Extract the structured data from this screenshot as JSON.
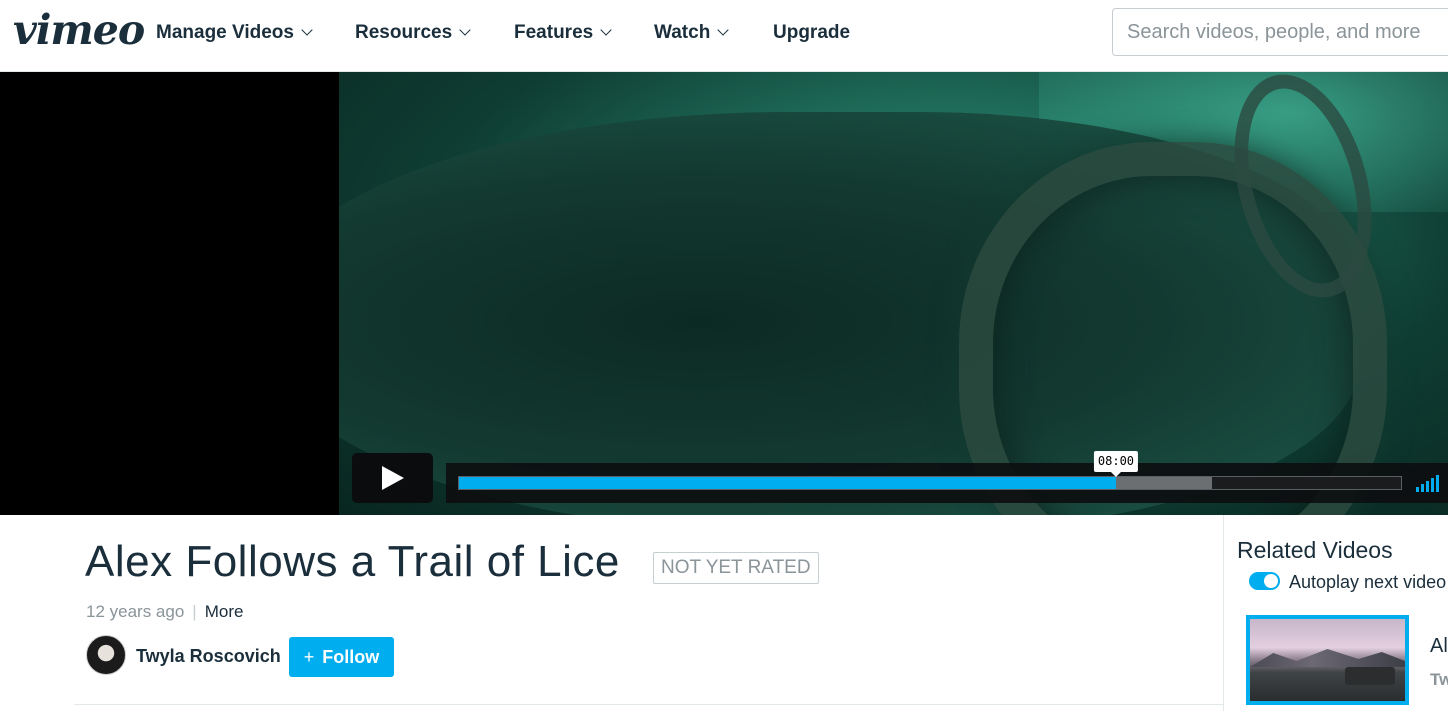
{
  "nav": {
    "logo": "vimeo",
    "items": [
      {
        "label": "Manage Videos",
        "has_dropdown": true
      },
      {
        "label": "Resources",
        "has_dropdown": true
      },
      {
        "label": "Features",
        "has_dropdown": true
      },
      {
        "label": "Watch",
        "has_dropdown": true
      },
      {
        "label": "Upgrade",
        "has_dropdown": false
      }
    ],
    "search_placeholder": "Search videos, people, and more"
  },
  "player": {
    "play_icon": "play-icon",
    "progress_played_fraction": 0.697,
    "progress_buffered_fraction": 0.799,
    "hover_time": "08:00",
    "accent_color": "#00adef"
  },
  "video": {
    "title": "Alex Follows a Trail of Lice",
    "rating": "NOT YET RATED",
    "age": "12 years ago",
    "more_label": "More",
    "owner": "Twyla Roscovich",
    "follow_label": "Follow",
    "follow_icon": "plus-icon"
  },
  "related": {
    "title": "Related Videos",
    "autoplay_label": "Autoplay next video",
    "autoplay_on": true,
    "items": [
      {
        "title": "Al",
        "owner": "Tw"
      }
    ]
  }
}
